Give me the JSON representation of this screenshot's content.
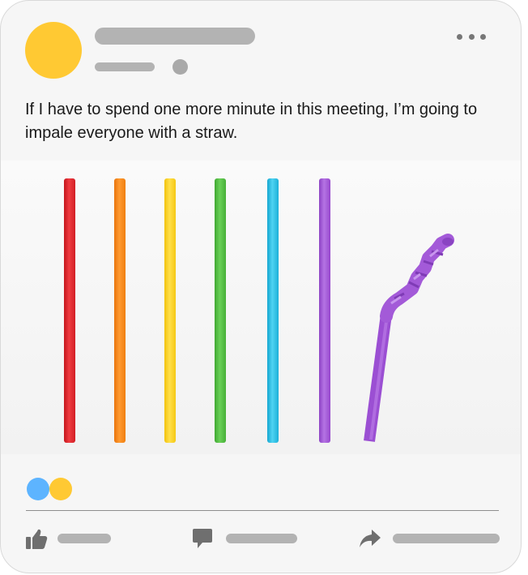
{
  "post": {
    "text": "If I have to spend one more minute in this meeting, I’m going to impale everyone with a straw."
  },
  "colors": {
    "avatar": "#ffc933",
    "reaction_blue": "#5db4ff",
    "reaction_yellow": "#ffc933",
    "straws": [
      "#e8242b",
      "#ff8c1a",
      "#ffd21f",
      "#57c244",
      "#2cc3e8",
      "#a35ad8",
      "#a35ad8"
    ]
  },
  "image": {
    "subject": "straws",
    "straw_count": 7
  },
  "icons": {
    "more": "more-options-icon",
    "like": "thumbs-up-icon",
    "comment": "comment-icon",
    "share": "share-icon"
  }
}
